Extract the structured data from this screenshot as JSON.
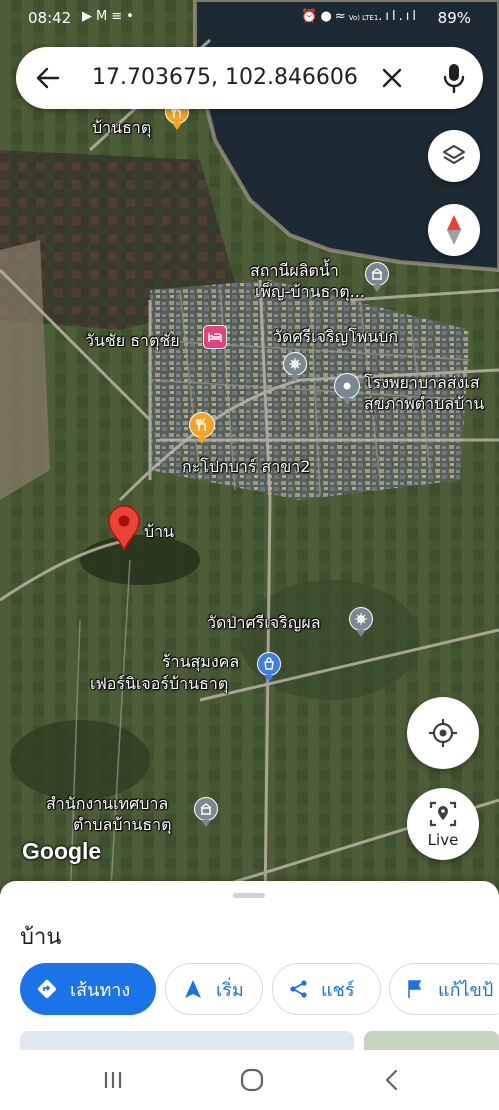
{
  "status_bar": {
    "time": "08:42",
    "notification_icons": [
      "youtube-icon",
      "gmail-icon",
      "message-icon",
      "dot-icon"
    ],
    "system_icons": [
      "alarm-icon",
      "location-icon",
      "wifi-icon",
      "volte-icon",
      "signal-icon"
    ],
    "volte_label": "Vo) LTE1",
    "battery": "89%"
  },
  "search": {
    "query": "17.703675, 102.846606"
  },
  "map": {
    "labels": {
      "ban_that_top": "บ้านธาตุ",
      "water_station_1": "สถานีผลิตน้ำ",
      "water_station_2": "เพ็ญ-บ้านธาตุ...",
      "wanchai": "วันชัย ธาตุชัย",
      "wat_sri_charoen": "วัดศรีเจริญโพนบก",
      "hospital_1": "โรงพยาบาลส่งเส",
      "hospital_2": "สุขภาพตำบลบ้าน",
      "kapok_bar": "กะโปกบาร์ สาขา2",
      "home_pin": "บ้าน",
      "wat_pa": "วัดป่าศรีเจริญผล",
      "furniture_1": "ร้านสุมงคล",
      "furniture_2": "เฟอร์นิเจอร์บ้านธาตุ",
      "municipal_1": "สำนักงานเทศบาล",
      "municipal_2": "ตำบลบ้านธาตุ"
    },
    "google_logo": "Google",
    "live_label": "Live"
  },
  "sheet": {
    "title": "บ้าน",
    "actions": {
      "directions": "เส้นทาง",
      "start": "เริ่ม",
      "share": "แชร์",
      "edit": "แก้ไขป้"
    }
  },
  "colors": {
    "accent": "#1a73e8",
    "pin_red": "#ea4335",
    "poi_gray": "#7b8791",
    "poi_orange": "#f4a322",
    "poi_pink": "#e5427a",
    "poi_blue": "#3d7fe0"
  }
}
